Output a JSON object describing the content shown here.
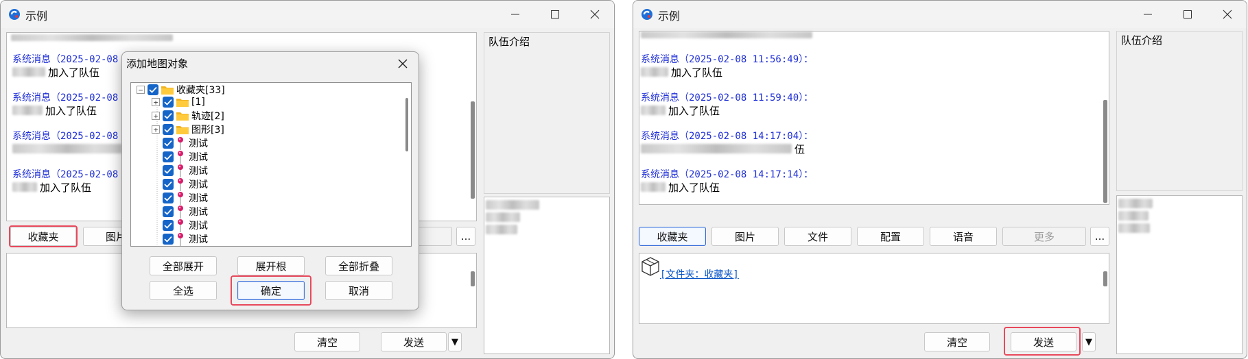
{
  "window_title": "示例",
  "team_intro_label": "队伍介绍",
  "messages_left": [
    {
      "head": "系统消息（2025-02-08 1",
      "body": "加入了队伍",
      "blur": 40
    },
    {
      "head": "系统消息（2025-02-08 1",
      "body": "加入了队伍",
      "blur": 40
    },
    {
      "head": "系统消息（2025-02-08 1",
      "body": "]",
      "blur": 140
    },
    {
      "head": "系统消息（2025-02-08 1",
      "body": "加入了队伍",
      "blur": 30
    }
  ],
  "messages_right": [
    {
      "head": "系统消息（2025-02-08 11:56:49）：",
      "body": "加入了队伍",
      "blur": 38
    },
    {
      "head": "系统消息（2025-02-08 11:59:40）：",
      "body": "加入了队伍",
      "blur": 34
    },
    {
      "head": "系统消息（2025-02-08 14:17:04）：",
      "body": "伍",
      "blur": 190
    },
    {
      "head": "系统消息（2025-02-08 14:17:14）：",
      "body": "加入了队伍",
      "blur": 34
    }
  ],
  "toolbar": {
    "favorites": "收藏夹",
    "picture": "图片",
    "file": "文件",
    "config": "配置",
    "voice": "语音",
    "more": "更多",
    "ellipsis": "..."
  },
  "actions": {
    "clear": "清空",
    "send": "发送",
    "send_dropdown": "▼"
  },
  "attachment_link": "[文件夹：收藏夹]",
  "dialog": {
    "title": "添加地图对象",
    "tree": {
      "root": "收藏夹[33]",
      "folders": [
        "[1]",
        "轨迹[2]",
        "图形[3]"
      ],
      "items": [
        "测试",
        "测试",
        "测试",
        "测试",
        "测试",
        "测试",
        "测试",
        "测试"
      ]
    },
    "buttons": {
      "expand_all": "全部展开",
      "expand_root": "展开根",
      "collapse_all": "全部折叠",
      "select_all": "全选",
      "ok": "确定",
      "cancel": "取消"
    }
  },
  "colors": {
    "system_message": "#1f2fd8",
    "highlight": "#e8485b",
    "checkbox": "#1565c8",
    "link": "#0b57c8"
  }
}
